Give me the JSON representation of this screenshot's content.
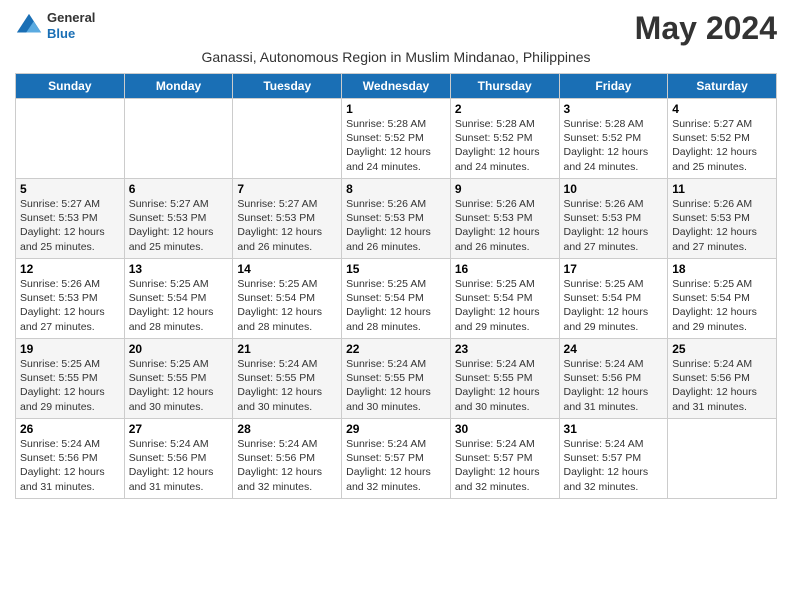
{
  "header": {
    "logo_general": "General",
    "logo_blue": "Blue",
    "month_year": "May 2024",
    "subtitle": "Ganassi, Autonomous Region in Muslim Mindanao, Philippines"
  },
  "days_of_week": [
    "Sunday",
    "Monday",
    "Tuesday",
    "Wednesday",
    "Thursday",
    "Friday",
    "Saturday"
  ],
  "weeks": [
    [
      {
        "day": "",
        "info": ""
      },
      {
        "day": "",
        "info": ""
      },
      {
        "day": "",
        "info": ""
      },
      {
        "day": "1",
        "info": "Sunrise: 5:28 AM\nSunset: 5:52 PM\nDaylight: 12 hours\nand 24 minutes."
      },
      {
        "day": "2",
        "info": "Sunrise: 5:28 AM\nSunset: 5:52 PM\nDaylight: 12 hours\nand 24 minutes."
      },
      {
        "day": "3",
        "info": "Sunrise: 5:28 AM\nSunset: 5:52 PM\nDaylight: 12 hours\nand 24 minutes."
      },
      {
        "day": "4",
        "info": "Sunrise: 5:27 AM\nSunset: 5:52 PM\nDaylight: 12 hours\nand 25 minutes."
      }
    ],
    [
      {
        "day": "5",
        "info": "Sunrise: 5:27 AM\nSunset: 5:53 PM\nDaylight: 12 hours\nand 25 minutes."
      },
      {
        "day": "6",
        "info": "Sunrise: 5:27 AM\nSunset: 5:53 PM\nDaylight: 12 hours\nand 25 minutes."
      },
      {
        "day": "7",
        "info": "Sunrise: 5:27 AM\nSunset: 5:53 PM\nDaylight: 12 hours\nand 26 minutes."
      },
      {
        "day": "8",
        "info": "Sunrise: 5:26 AM\nSunset: 5:53 PM\nDaylight: 12 hours\nand 26 minutes."
      },
      {
        "day": "9",
        "info": "Sunrise: 5:26 AM\nSunset: 5:53 PM\nDaylight: 12 hours\nand 26 minutes."
      },
      {
        "day": "10",
        "info": "Sunrise: 5:26 AM\nSunset: 5:53 PM\nDaylight: 12 hours\nand 27 minutes."
      },
      {
        "day": "11",
        "info": "Sunrise: 5:26 AM\nSunset: 5:53 PM\nDaylight: 12 hours\nand 27 minutes."
      }
    ],
    [
      {
        "day": "12",
        "info": "Sunrise: 5:26 AM\nSunset: 5:53 PM\nDaylight: 12 hours\nand 27 minutes."
      },
      {
        "day": "13",
        "info": "Sunrise: 5:25 AM\nSunset: 5:54 PM\nDaylight: 12 hours\nand 28 minutes."
      },
      {
        "day": "14",
        "info": "Sunrise: 5:25 AM\nSunset: 5:54 PM\nDaylight: 12 hours\nand 28 minutes."
      },
      {
        "day": "15",
        "info": "Sunrise: 5:25 AM\nSunset: 5:54 PM\nDaylight: 12 hours\nand 28 minutes."
      },
      {
        "day": "16",
        "info": "Sunrise: 5:25 AM\nSunset: 5:54 PM\nDaylight: 12 hours\nand 29 minutes."
      },
      {
        "day": "17",
        "info": "Sunrise: 5:25 AM\nSunset: 5:54 PM\nDaylight: 12 hours\nand 29 minutes."
      },
      {
        "day": "18",
        "info": "Sunrise: 5:25 AM\nSunset: 5:54 PM\nDaylight: 12 hours\nand 29 minutes."
      }
    ],
    [
      {
        "day": "19",
        "info": "Sunrise: 5:25 AM\nSunset: 5:55 PM\nDaylight: 12 hours\nand 29 minutes."
      },
      {
        "day": "20",
        "info": "Sunrise: 5:25 AM\nSunset: 5:55 PM\nDaylight: 12 hours\nand 30 minutes."
      },
      {
        "day": "21",
        "info": "Sunrise: 5:24 AM\nSunset: 5:55 PM\nDaylight: 12 hours\nand 30 minutes."
      },
      {
        "day": "22",
        "info": "Sunrise: 5:24 AM\nSunset: 5:55 PM\nDaylight: 12 hours\nand 30 minutes."
      },
      {
        "day": "23",
        "info": "Sunrise: 5:24 AM\nSunset: 5:55 PM\nDaylight: 12 hours\nand 30 minutes."
      },
      {
        "day": "24",
        "info": "Sunrise: 5:24 AM\nSunset: 5:56 PM\nDaylight: 12 hours\nand 31 minutes."
      },
      {
        "day": "25",
        "info": "Sunrise: 5:24 AM\nSunset: 5:56 PM\nDaylight: 12 hours\nand 31 minutes."
      }
    ],
    [
      {
        "day": "26",
        "info": "Sunrise: 5:24 AM\nSunset: 5:56 PM\nDaylight: 12 hours\nand 31 minutes."
      },
      {
        "day": "27",
        "info": "Sunrise: 5:24 AM\nSunset: 5:56 PM\nDaylight: 12 hours\nand 31 minutes."
      },
      {
        "day": "28",
        "info": "Sunrise: 5:24 AM\nSunset: 5:56 PM\nDaylight: 12 hours\nand 32 minutes."
      },
      {
        "day": "29",
        "info": "Sunrise: 5:24 AM\nSunset: 5:57 PM\nDaylight: 12 hours\nand 32 minutes."
      },
      {
        "day": "30",
        "info": "Sunrise: 5:24 AM\nSunset: 5:57 PM\nDaylight: 12 hours\nand 32 minutes."
      },
      {
        "day": "31",
        "info": "Sunrise: 5:24 AM\nSunset: 5:57 PM\nDaylight: 12 hours\nand 32 minutes."
      },
      {
        "day": "",
        "info": ""
      }
    ]
  ]
}
